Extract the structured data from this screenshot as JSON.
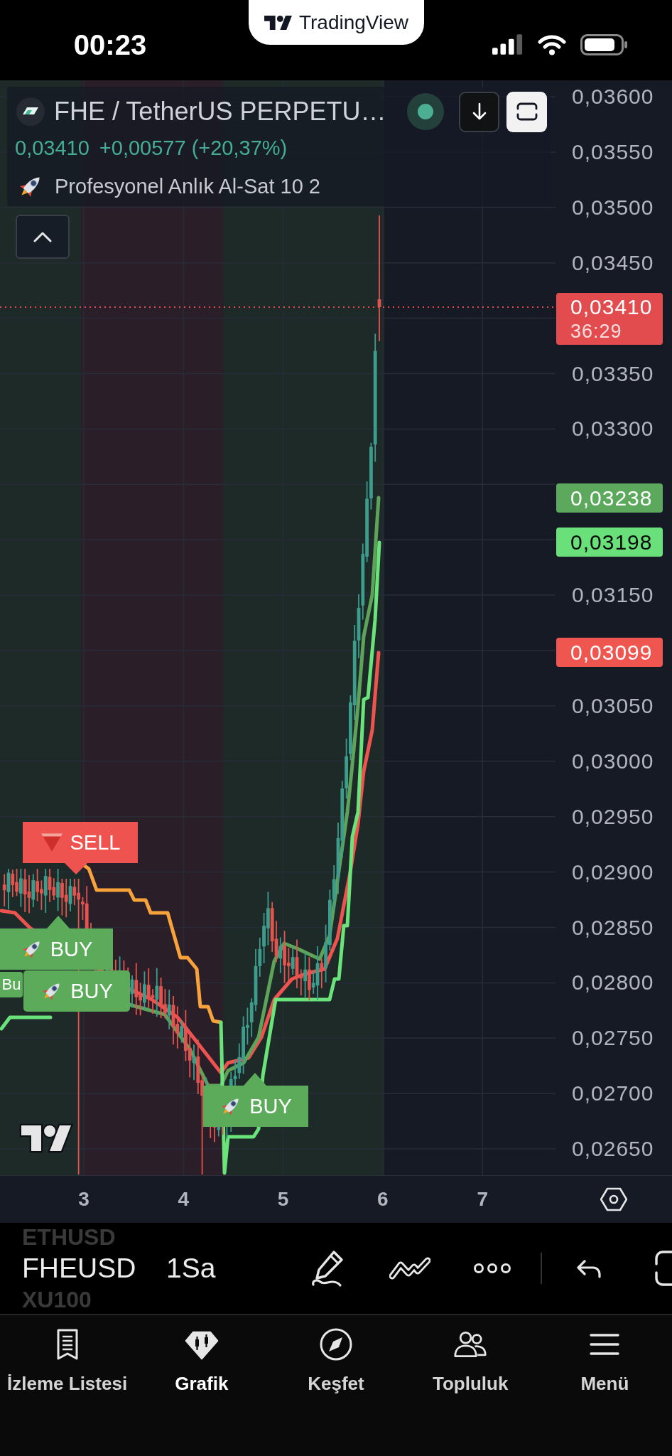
{
  "status_bar": {
    "time": "00:23",
    "app_pill": "TradingView"
  },
  "legend": {
    "symbol": "FHE / TetherUS PERPETU…",
    "last_price": "0,03410",
    "change": "+0,00577 (+20,37%)",
    "indicator": "Profesyonel Anlık Al-Sat 10 2"
  },
  "price_axis": {
    "ticks": [
      "0,03600",
      "0,03550",
      "0,03500",
      "0,03450",
      "0,03350",
      "0,03300",
      "0,03150",
      "0,03050",
      "0,03000",
      "0,02950",
      "0,02900",
      "0,02850",
      "0,02800",
      "0,02750",
      "0,02700",
      "0,02650"
    ],
    "markers": [
      {
        "kind": "last",
        "price": "0,03410",
        "countdown": "36:29",
        "color": "#e24c4f"
      },
      {
        "kind": "line",
        "price": "0,03238",
        "color": "#5ca85c"
      },
      {
        "kind": "line",
        "price": "0,03198",
        "color": "#69e07a"
      },
      {
        "kind": "line",
        "price": "0,03099",
        "color": "#ef5650"
      }
    ]
  },
  "signals": [
    {
      "kind": "sell",
      "label": "SELL"
    },
    {
      "kind": "buy",
      "label": "BUY"
    },
    {
      "kind": "buy",
      "label": "Bu"
    },
    {
      "kind": "buy",
      "label": "BUY"
    },
    {
      "kind": "buy",
      "label": "BUY"
    }
  ],
  "time_axis": {
    "labels": [
      "3",
      "4",
      "5",
      "6",
      "7"
    ]
  },
  "toolbar": {
    "symbols": [
      {
        "label": "ETHUSD",
        "selected": false
      },
      {
        "label": "FHEUSD",
        "selected": true
      },
      {
        "label": "XU100",
        "selected": false
      }
    ],
    "interval": "1Sa"
  },
  "nav": {
    "items": [
      {
        "label": "İzleme Listesi",
        "selected": false
      },
      {
        "label": "Grafik",
        "selected": true
      },
      {
        "label": "Keşfet",
        "selected": false
      },
      {
        "label": "Topluluk",
        "selected": false
      },
      {
        "label": "Menü",
        "selected": false
      }
    ]
  }
}
